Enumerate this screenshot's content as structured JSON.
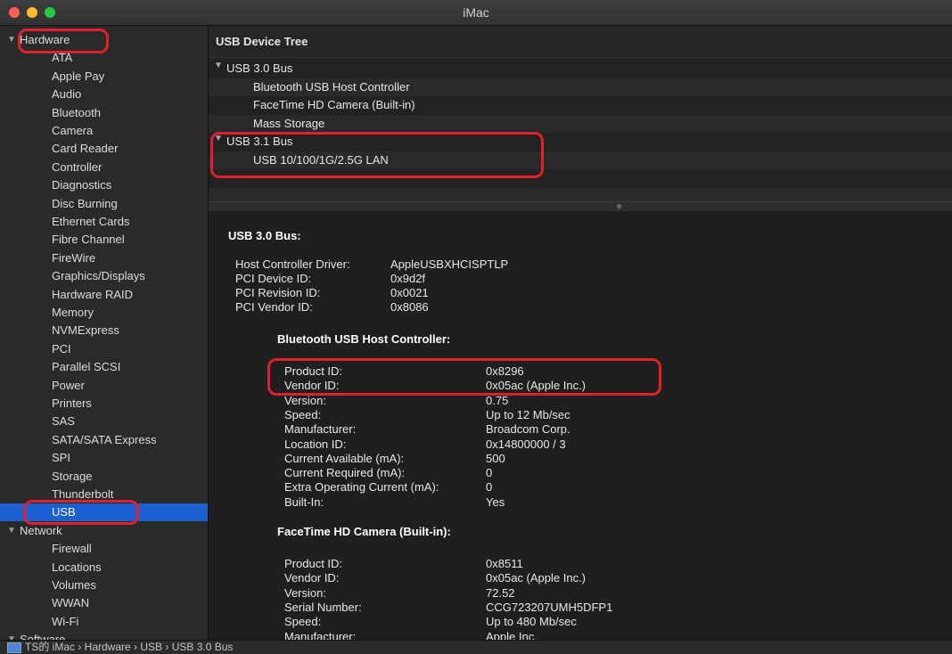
{
  "window": {
    "title": "iMac"
  },
  "sidebar": {
    "hardware": "Hardware",
    "hardware_items": [
      "ATA",
      "Apple Pay",
      "Audio",
      "Bluetooth",
      "Camera",
      "Card Reader",
      "Controller",
      "Diagnostics",
      "Disc Burning",
      "Ethernet Cards",
      "Fibre Channel",
      "FireWire",
      "Graphics/Displays",
      "Hardware RAID",
      "Memory",
      "NVMExpress",
      "PCI",
      "Parallel SCSI",
      "Power",
      "Printers",
      "SAS",
      "SATA/SATA Express",
      "SPI",
      "Storage",
      "Thunderbolt",
      "USB"
    ],
    "network": "Network",
    "network_items": [
      "Firewall",
      "Locations",
      "Volumes",
      "WWAN",
      "Wi-Fi"
    ],
    "software": "Software",
    "selected": "USB"
  },
  "tree": {
    "header": "USB Device Tree",
    "bus1": "USB 3.0 Bus",
    "bus1_devices": [
      "Bluetooth USB Host Controller",
      "FaceTime HD Camera (Built-in)",
      "Mass Storage"
    ],
    "bus2": "USB 3.1 Bus",
    "bus2_devices": [
      "USB 10/100/1G/2.5G LAN"
    ]
  },
  "detail": {
    "bus_title": "USB 3.0 Bus:",
    "bus_props": [
      {
        "k": "Host Controller Driver:",
        "v": "AppleUSBXHCISPTLP"
      },
      {
        "k": "PCI Device ID:",
        "v": "0x9d2f"
      },
      {
        "k": "PCI Revision ID:",
        "v": "0x0021"
      },
      {
        "k": "PCI Vendor ID:",
        "v": "0x8086"
      }
    ],
    "dev1_title": "Bluetooth USB Host Controller:",
    "dev1_props": [
      {
        "k": "Product ID:",
        "v": "0x8296"
      },
      {
        "k": "Vendor ID:",
        "v": "0x05ac (Apple Inc.)"
      },
      {
        "k": "Version:",
        "v": "0.75"
      },
      {
        "k": "Speed:",
        "v": "Up to 12 Mb/sec"
      },
      {
        "k": "Manufacturer:",
        "v": "Broadcom Corp."
      },
      {
        "k": "Location ID:",
        "v": "0x14800000 / 3"
      },
      {
        "k": "Current Available (mA):",
        "v": "500"
      },
      {
        "k": "Current Required (mA):",
        "v": "0"
      },
      {
        "k": "Extra Operating Current (mA):",
        "v": "0"
      },
      {
        "k": "Built-In:",
        "v": "Yes"
      }
    ],
    "dev2_title": "FaceTime HD Camera (Built-in):",
    "dev2_props": [
      {
        "k": "Product ID:",
        "v": "0x8511"
      },
      {
        "k": "Vendor ID:",
        "v": "0x05ac (Apple Inc.)"
      },
      {
        "k": "Version:",
        "v": "72.52"
      },
      {
        "k": "Serial Number:",
        "v": "CCG723207UMH5DFP1"
      },
      {
        "k": "Speed:",
        "v": "Up to 480 Mb/sec"
      },
      {
        "k": "Manufacturer:",
        "v": "Apple Inc."
      }
    ]
  },
  "statusbar": {
    "path": "TS的 iMac › Hardware › USB › USB 3.0 Bus"
  },
  "colors": {
    "selection": "#1b5fd0",
    "annotation": "#e0202a"
  }
}
